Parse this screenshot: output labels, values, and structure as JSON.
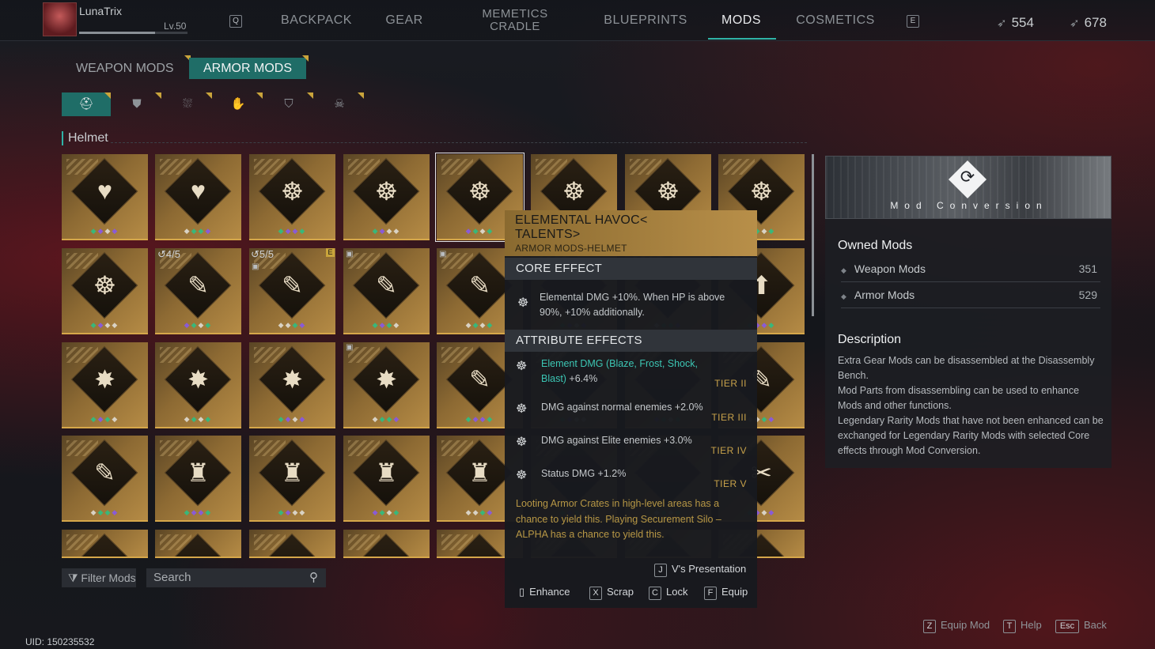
{
  "player": {
    "name": "LunaTrix",
    "level": "Lv.50"
  },
  "nav": {
    "left_key": "Q",
    "right_key": "E",
    "tabs": [
      "BACKPACK",
      "GEAR",
      "MEMETICS",
      "CRADLE",
      "BLUEPRINTS",
      "MODS",
      "COSMETICS"
    ],
    "active": "MODS"
  },
  "currency": {
    "a": "554",
    "b": "678"
  },
  "subtabs": {
    "weapon": "WEAPON MODS",
    "armor": "ARMOR MODS"
  },
  "slot_icons": [
    "helmet-icon",
    "chest-icon",
    "pants-icon",
    "gloves-icon",
    "mask-icon",
    "boots-icon"
  ],
  "section": "Helmet",
  "badges": {
    "b1": "↺4/5",
    "b2": "↺5/5",
    "e": "E"
  },
  "tooltip": {
    "title": "ELEMENTAL HAVOC<",
    "title2": "TALENTS>",
    "subtitle": "ARMOR MODS-HELMET",
    "core_header": "CORE EFFECT",
    "core_line1": "Elemental DMG +10%. When HP is above",
    "core_line2": "90%, +10% additionally.",
    "attr_header": "ATTRIBUTE EFFECTS",
    "attr1_a": "Element DMG (Blaze, Frost, Shock,",
    "attr1_b": "Blast)",
    "attr1_c": " +6.4%",
    "attr1_tier": "TIER II",
    "attr2": "DMG against normal enemies +2.0%",
    "attr2_tier": "TIER III",
    "attr3": "DMG against Elite enemies +3.0%",
    "attr3_tier": "TIER IV",
    "attr4": "Status DMG +1.2%",
    "attr4_tier": "TIER V",
    "source": "Looting Armor Crates in high-level areas has a chance to yield this. Playing Securement Silo – ALPHA has a chance to yield this.",
    "presentation_key": "J",
    "presentation": "V's Presentation",
    "enhance": "Enhance",
    "scrap_key": "X",
    "scrap": "Scrap",
    "lock_key": "C",
    "lock": "Lock",
    "equip_key": "F",
    "equip": "Equip"
  },
  "right_panel": {
    "banner": "Mod Conversion",
    "owned_title": "Owned Mods",
    "weapon_label": "Weapon Mods",
    "weapon_count": "351",
    "armor_label": "Armor Mods",
    "armor_count": "529",
    "desc_title": "Description",
    "desc1": "Extra Gear Mods can be disassembled at the Disassembly Bench.",
    "desc2": "Mod Parts from disassembling can be used to enhance Mods and other functions.",
    "desc3": "Legendary Rarity Mods that have not been enhanced can be exchanged for Legendary Rarity Mods with selected Core effects through Mod Conversion."
  },
  "bottom": {
    "filter": "Filter Mods",
    "search_placeholder": "Search",
    "equip_key": "Z",
    "equip_mod": "Equip Mod",
    "help_key": "T",
    "help": "Help",
    "back_key": "Esc",
    "back": "Back",
    "uid": "UID: 150235532"
  },
  "colors": {
    "accent": "#1f6d67",
    "gold": "#c9a43b",
    "tier": "#c8a24a",
    "teal_text": "#3cc6b4"
  }
}
